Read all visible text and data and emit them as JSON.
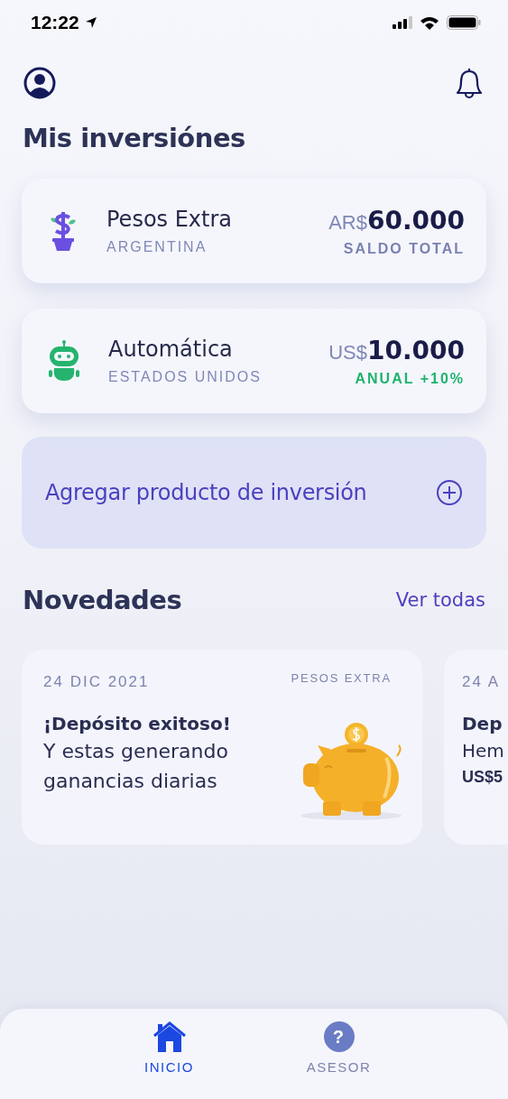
{
  "status_bar": {
    "time": "12:22"
  },
  "title": "Mis inversiónes",
  "investments": [
    {
      "kind": "plant",
      "name": "Pesos Extra",
      "country": "ARGENTINA",
      "currency": "AR$",
      "amount": "60.000",
      "note": "SALDO TOTAL",
      "positive": false
    },
    {
      "kind": "robot",
      "name": "Automática",
      "country": "ESTADOS UNIDOS",
      "currency": "US$",
      "amount": "10.000",
      "note": "ANUAL +10%",
      "positive": true
    }
  ],
  "add_product": {
    "label": "Agregar producto de inversión"
  },
  "news": {
    "title": "Novedades",
    "link": "Ver todas",
    "cards": [
      {
        "date": "24 DIC 2021",
        "tag": "PESOS EXTRA",
        "headline": "¡Depósito exitoso!",
        "body": "Y estas generando ganancias diarias",
        "kind": "piggy"
      },
      {
        "date": "24 A",
        "headline": "Dep",
        "body": "Hem",
        "amount": "US$5",
        "kind": "text"
      }
    ]
  },
  "tab_bar": [
    {
      "label": "INICIO",
      "kind": "home",
      "selected": true
    },
    {
      "label": "ASESOR",
      "kind": "help",
      "glyph": "?",
      "selected": false
    }
  ]
}
